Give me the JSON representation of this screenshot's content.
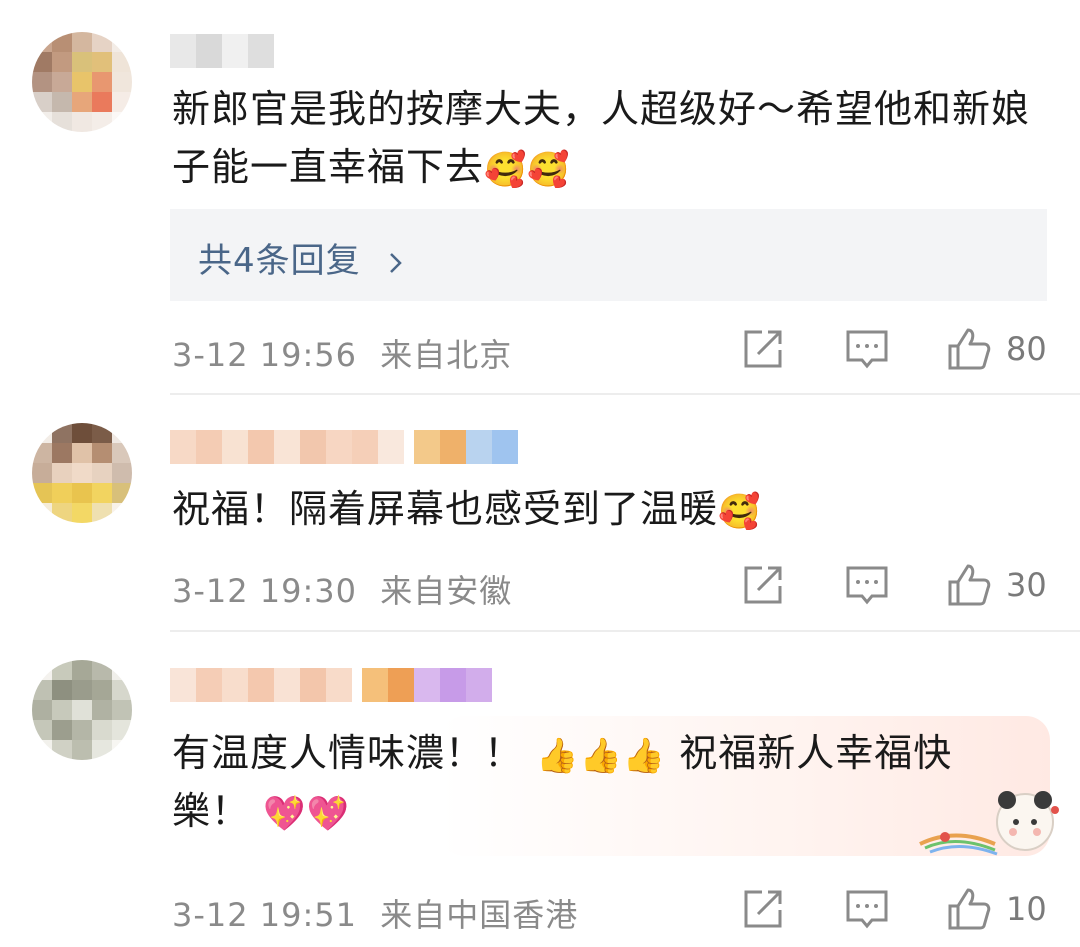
{
  "comments": [
    {
      "text": "新郎官是我的按摩大夫，人超级好～希望他和新娘子能一直幸福下去",
      "emojis": "🥰🥰",
      "replies_label": "共4条回复",
      "timestamp": "3-12 19:56",
      "location": "来自北京",
      "likes": "80"
    },
    {
      "text": "祝福！隔着屏幕也感受到了温暖",
      "emojis": "🥰",
      "timestamp": "3-12 19:30",
      "location": "来自安徽",
      "likes": "30"
    },
    {
      "text_line1": "有温度人情味濃！！",
      "thumbs": "👍👍👍",
      "text_line1b": "祝福新人幸福快",
      "text_line2": "樂！",
      "hearts": "💖💖",
      "timestamp": "3-12 19:51",
      "location": "来自中国香港",
      "likes": "10"
    }
  ],
  "colors": {
    "text": "#1a1a1a",
    "meta": "#8a8a8a",
    "reply_link": "#4a6688",
    "reply_bg": "#f3f4f6"
  },
  "icons": [
    "share-icon",
    "comment-icon",
    "like-icon",
    "chevron-right-icon"
  ]
}
